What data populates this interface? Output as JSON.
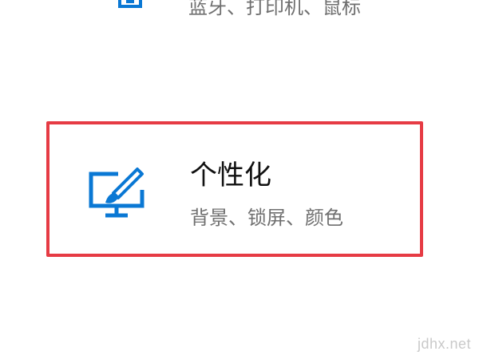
{
  "items": [
    {
      "icon": "devices-icon",
      "description": "蓝牙、打印机、鼠标"
    },
    {
      "icon": "personalization-icon",
      "title": "个性化",
      "description": "背景、锁屏、颜色",
      "highlight_color": "#e63b44"
    }
  ],
  "accent_color": "#0a78d4",
  "watermark": "jdhx.net"
}
